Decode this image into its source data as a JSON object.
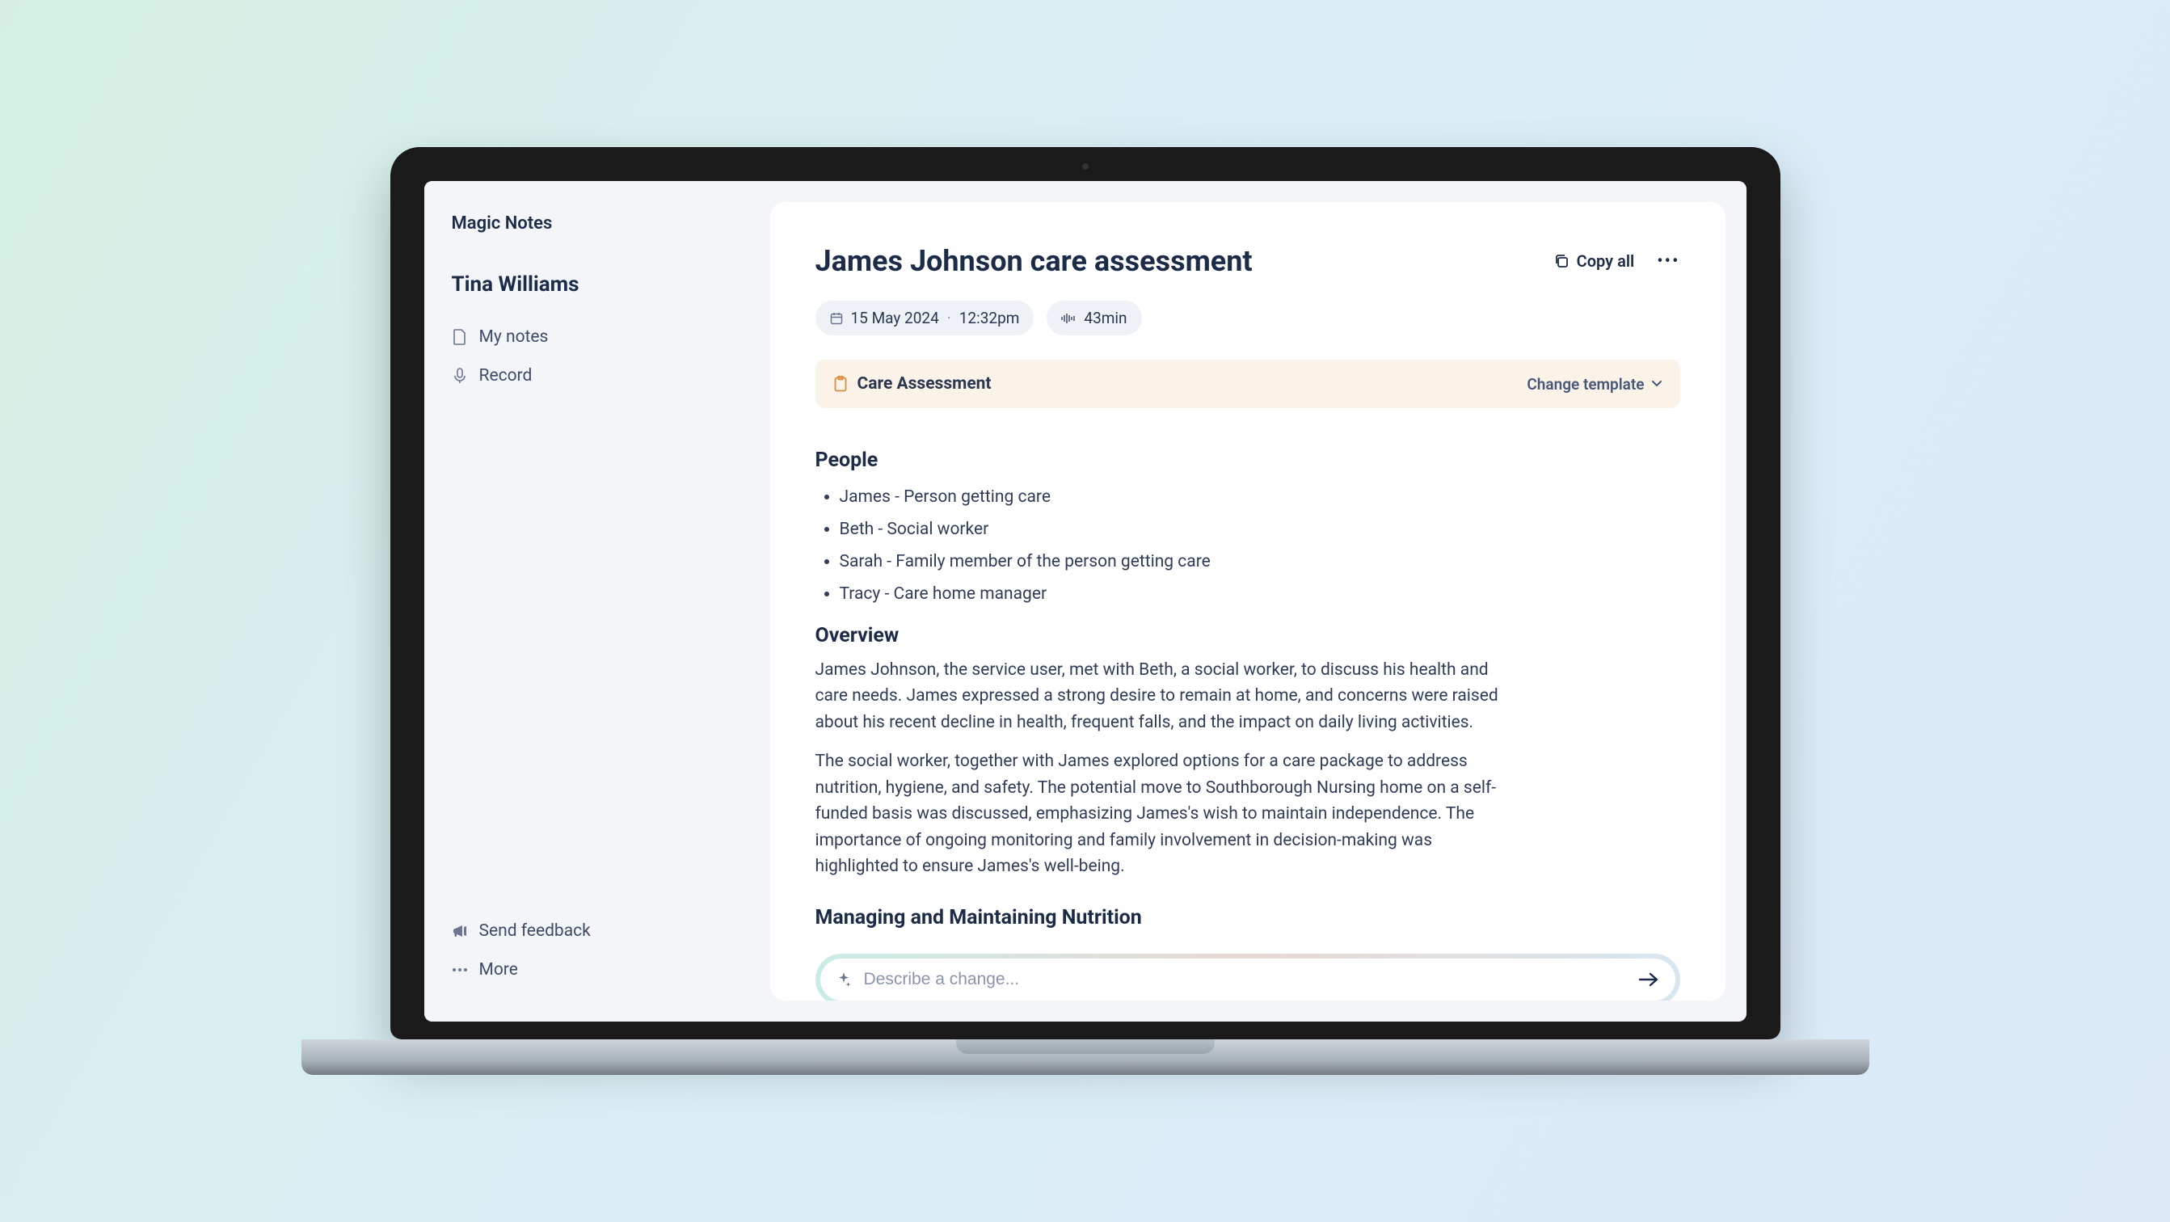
{
  "brand": "Magic Notes",
  "user": {
    "name": "Tina Williams"
  },
  "sidebar": {
    "items": [
      {
        "icon": "document-icon",
        "label": "My notes"
      },
      {
        "icon": "mic-icon",
        "label": "Record"
      }
    ],
    "footer": [
      {
        "icon": "megaphone-icon",
        "label": "Send feedback"
      },
      {
        "icon": "dots-icon",
        "label": "More"
      }
    ]
  },
  "doc": {
    "title": "James Johnson care assessment",
    "actions": {
      "copy_all": "Copy all"
    },
    "meta": {
      "date": "15 May 2024",
      "time": "12:32pm",
      "duration": "43min"
    },
    "template": {
      "name": "Care Assessment",
      "change_label": "Change template"
    },
    "sections": {
      "people_title": "People",
      "people": [
        "James - Person getting care",
        "Beth - Social worker",
        "Sarah -  Family member of the person getting care",
        "Tracy - Care home manager"
      ],
      "overview_title": "Overview",
      "overview_paragraphs": [
        "James Johnson, the service user, met with Beth, a social worker, to discuss his health and care needs. James expressed a strong desire to remain at home, and concerns were raised about his recent decline in health, frequent falls, and the impact on daily living activities.",
        "The social worker, together with James explored options for a care package to address nutrition, hygiene, and safety. The potential move to Southborough Nursing home on a self-funded basis was discussed, emphasizing James's wish to maintain independence. The importance of ongoing monitoring and family involvement in decision-making was highlighted to ensure James's well-being."
      ],
      "nutrition_title": "Managing and Maintaining Nutrition"
    },
    "prompt_placeholder": "Describe a change..."
  }
}
